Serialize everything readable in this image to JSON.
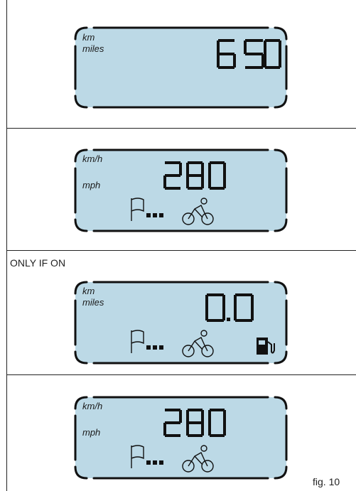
{
  "panels": [
    {
      "units_top": "km",
      "units_bottom": "miles",
      "reading": "6 50"
    },
    {
      "units_top": "km/h",
      "units_bottom": "mph",
      "reading": "280"
    },
    {
      "units_top": "km",
      "units_bottom": "miles",
      "reading": "0.0"
    },
    {
      "units_top": "km/h",
      "units_bottom": "mph",
      "reading": "280"
    }
  ],
  "caption_only_if_on": "ONLY IF ON",
  "figure_label": "fig. 10",
  "icons": {
    "flag": "flag-icon",
    "dots": "dots-icon",
    "cyclist": "cyclist-icon",
    "fuel": "fuel-pump-icon"
  },
  "colors": {
    "lcd_fill": "#bcd9e6",
    "lcd_border": "#111111",
    "rule": "#222222"
  }
}
